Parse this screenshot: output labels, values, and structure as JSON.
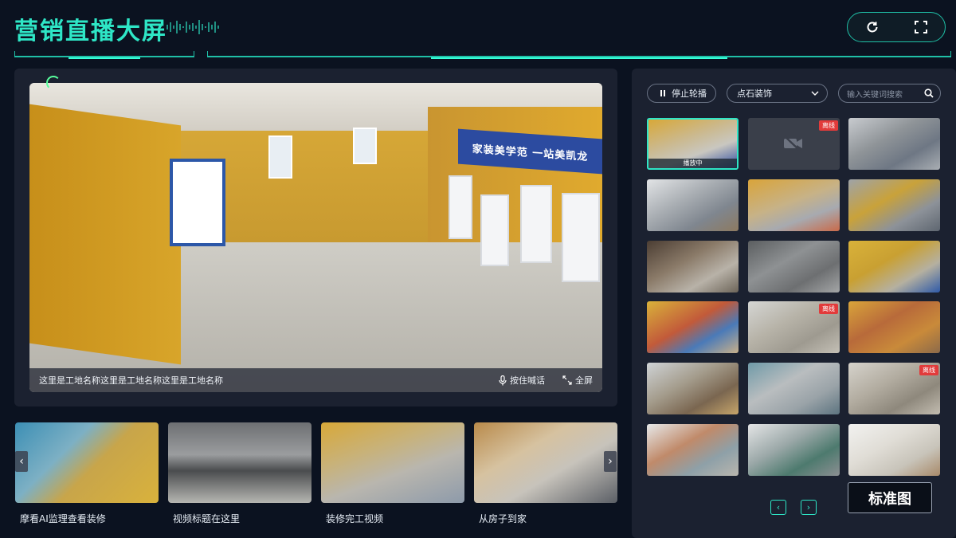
{
  "header": {
    "title": "营销直播大屏",
    "refresh_icon": "refresh-icon",
    "fullscreen_icon": "fullscreen-icon"
  },
  "main_video": {
    "banner_text": "家装美学范  一站美凯龙",
    "caption": "这里是工地名称这里是工地名称这里是工地名称",
    "hold_to_talk_label": "按住喊话",
    "fullscreen_label": "全屏",
    "mic_icon": "microphone-icon",
    "expand_icon": "expand-icon"
  },
  "recommendations": [
    {
      "label": "摩看AI监理查看装修"
    },
    {
      "label": "视频标题在这里"
    },
    {
      "label": "装修完工视频"
    },
    {
      "label": "从房子到家"
    }
  ],
  "sidebar": {
    "stop_rotation_label": "停止轮播",
    "company_select_value": "点石装饰",
    "search_placeholder": "输入关键词搜索",
    "playing_label": "播放中",
    "offline_label": "离线",
    "standard_view_label": "标准图",
    "prev_page": "‹",
    "next_page": "›"
  },
  "colors": {
    "accent": "#2ee6c6",
    "background": "#0b1220",
    "panel": "#1b2130",
    "offline_badge": "#e23b3b"
  }
}
